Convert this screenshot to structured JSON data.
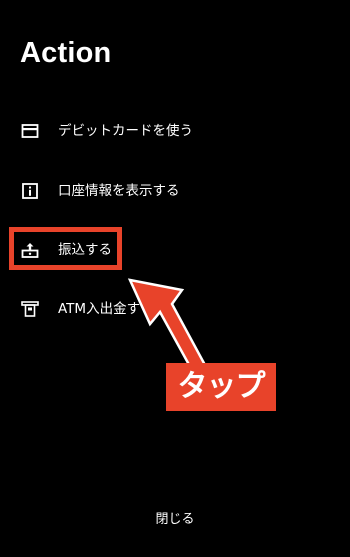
{
  "screen": {
    "title": "Action"
  },
  "menu": {
    "items": [
      {
        "label": "デビットカードを使う",
        "icon": "card-icon"
      },
      {
        "label": "口座情報を表示する",
        "icon": "info-icon"
      },
      {
        "label": "振込する",
        "icon": "transfer-icon"
      },
      {
        "label": "ATM入出金す",
        "icon": "atm-icon"
      }
    ]
  },
  "annotation": {
    "tap_label": "タップ",
    "accent_color": "#e8432a"
  },
  "footer": {
    "close_label": "閉じる"
  }
}
